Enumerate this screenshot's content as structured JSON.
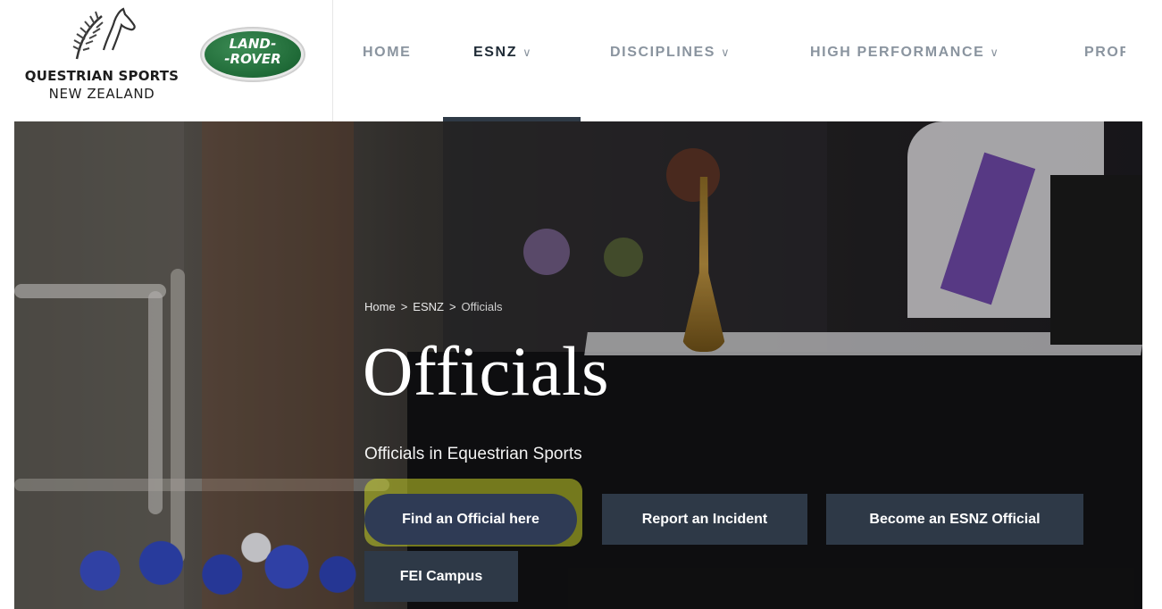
{
  "brand": {
    "esnz_line1": "QUESTRIAN SPORTS",
    "esnz_line2": "NEW ZEALAND",
    "partner_line1": "LAND",
    "partner_line2": "ROVER"
  },
  "nav": {
    "items": [
      {
        "label": "HOME",
        "chevron": false
      },
      {
        "label": "ESNZ",
        "chevron": true
      },
      {
        "label": "DISCIPLINES",
        "chevron": true
      },
      {
        "label": "HIGH PERFORMANCE",
        "chevron": true
      },
      {
        "label": "PROFI",
        "chevron": false
      }
    ],
    "active": "ESNZ"
  },
  "hero": {
    "breadcrumb": [
      "Home",
      "ESNZ",
      "Officials"
    ],
    "breadcrumb_sep": ">",
    "title": "Officials",
    "subtitle": "Officials in Equestrian Sports",
    "buttons": [
      {
        "label": "Find an Official here",
        "highlighted": true
      },
      {
        "label": "Report an Incident",
        "highlighted": false
      },
      {
        "label": "Become an ESNZ Official",
        "highlighted": false
      },
      {
        "label": "FEI Campus",
        "highlighted": false
      }
    ]
  },
  "colors": {
    "nav_text": "#8a949f",
    "nav_active": "#1f2b36",
    "button_bg": "#2e3947",
    "brand_green": "#1f6a37",
    "highlight": "#c8d228"
  },
  "icons": {
    "logo": "horse-fern-icon",
    "chevron": "chevron-down-icon"
  }
}
